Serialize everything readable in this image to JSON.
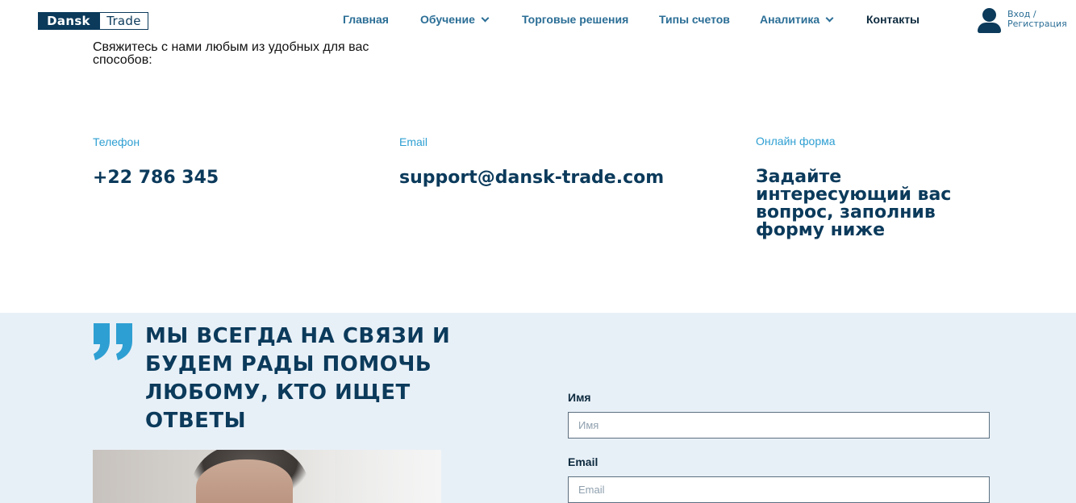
{
  "header": {
    "logo": {
      "part1": "Dansk",
      "part2": "Trade"
    },
    "nav": [
      {
        "label": "Главная",
        "has_dropdown": false
      },
      {
        "label": "Обучение",
        "has_dropdown": true
      },
      {
        "label": "Торговые решения",
        "has_dropdown": false
      },
      {
        "label": "Типы счетов",
        "has_dropdown": false
      },
      {
        "label": "Аналитика",
        "has_dropdown": true
      },
      {
        "label": "Контакты",
        "has_dropdown": false,
        "active": true
      }
    ],
    "login": {
      "line1": "Вход /",
      "line2": "Регистрация",
      "icon": "user-icon"
    }
  },
  "intro": {
    "text": "Свяжитесь с нами любым из удобных для вас способов:"
  },
  "contacts": {
    "phone": {
      "label": "Телефон",
      "value": "+22 786 345"
    },
    "email": {
      "label": "Email",
      "value": "support@dansk-trade.com"
    },
    "online": {
      "label": "Онлайн форма",
      "value": "Задайте интересующий вас вопрос, заполнив форму ниже"
    }
  },
  "section": {
    "quote_icon": "quote-icon",
    "headline": "МЫ ВСЕГДА НА СВЯЗИ И БУДЕМ РАДЫ ПОМОЧЬ ЛЮБОМУ, КТО ИЩЕТ ОТВЕТЫ"
  },
  "form": {
    "name": {
      "label": "Имя",
      "placeholder": "Имя",
      "value": ""
    },
    "email": {
      "label": "Email",
      "placeholder": "Email",
      "value": ""
    }
  },
  "colors": {
    "brand_dark": "#0b3a5b",
    "nav_link": "#2b6e96",
    "accent_blue": "#2e9fd2",
    "section_bg": "#e8f0f7"
  }
}
